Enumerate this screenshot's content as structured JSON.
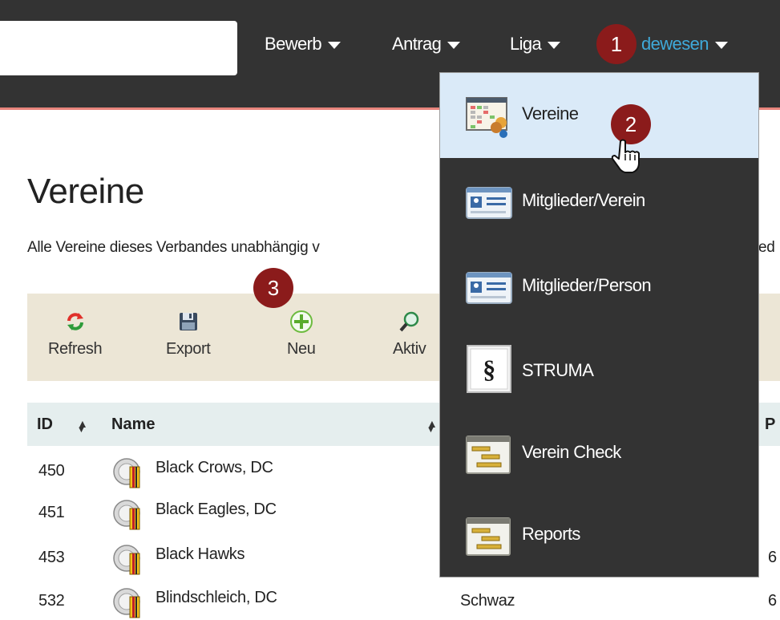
{
  "nav": {
    "search_value": "",
    "items": [
      {
        "label": "Bewerb"
      },
      {
        "label": "Antrag"
      },
      {
        "label": "Liga"
      },
      {
        "label": "dewesen"
      }
    ]
  },
  "markers": [
    "1",
    "2",
    "3"
  ],
  "dropdown": {
    "items": [
      {
        "label": "Vereine",
        "icon": "clubs-grid-icon"
      },
      {
        "label": "Mitglieder/Verein",
        "icon": "id-card-icon"
      },
      {
        "label": "Mitglieder/Person",
        "icon": "id-card-icon"
      },
      {
        "label": "STRUMA",
        "icon": "paragraph-icon"
      },
      {
        "label": "Verein Check",
        "icon": "gantt-icon"
      },
      {
        "label": "Reports",
        "icon": "gantt-icon"
      }
    ]
  },
  "page": {
    "title": "Vereine",
    "description": "Alle Vereine dieses Verbandes unabhängig v",
    "description_tail": "ed"
  },
  "toolbar": {
    "refresh": "Refresh",
    "export": "Export",
    "neu": "Neu",
    "aktiv": "Aktiv"
  },
  "table": {
    "headers": {
      "id": "ID",
      "name": "Name",
      "col4_partial": "P"
    },
    "rows": [
      {
        "id": "450",
        "name": "Black Crows, DC",
        "city": "",
        "extra": ""
      },
      {
        "id": "451",
        "name": "Black Eagles, DC",
        "city": "",
        "extra": ""
      },
      {
        "id": "453",
        "name": "Black Hawks",
        "city": "",
        "extra": "6"
      },
      {
        "id": "532",
        "name": "Blindschleich, DC",
        "city": "Schwaz",
        "extra": "6"
      }
    ]
  },
  "colors": {
    "topbar": "#333333",
    "marker": "#8b1b1b",
    "active_nav": "#3fa9d9",
    "highlight": "#daeaf8",
    "toolbar_bg": "#ece6d6",
    "table_head_bg": "#e5eeee"
  }
}
